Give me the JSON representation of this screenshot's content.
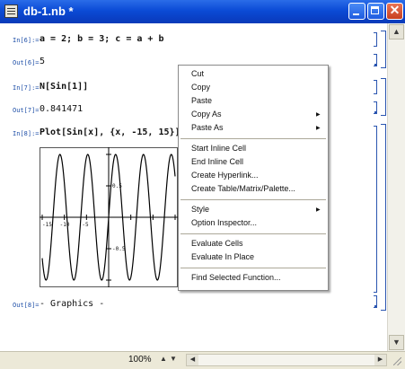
{
  "window": {
    "title": "db-1.nb *"
  },
  "cells": [
    {
      "in_label": "In[6]:=",
      "input": "a = 2; b = 3; c = a + b",
      "out_label": "Out[6]=",
      "output": "5"
    },
    {
      "in_label": "In[7]:=",
      "input": "N[Sin[1]]",
      "out_label": "Out[7]=",
      "output": "0.841471"
    },
    {
      "in_label": "In[8]:=",
      "input": "Plot[Sin[x], {x, -15, 15}]",
      "out_label": "Out[8]=",
      "output": "- Graphics -"
    }
  ],
  "plot": {
    "xticks": [
      "-15",
      "-10",
      "-5"
    ],
    "yticks": [
      "0.5",
      "-0.5"
    ]
  },
  "chart_data": {
    "type": "line",
    "function": "Sin[x]",
    "xlim": [
      -15,
      15
    ],
    "ylim": [
      -1,
      1
    ],
    "xticks": [
      -15,
      -10,
      -5,
      0,
      5,
      10,
      15
    ],
    "yticks": [
      -1,
      -0.5,
      0.5,
      1
    ],
    "series": [
      {
        "values_note": ""
      }
    ]
  },
  "context_menu": {
    "items": [
      {
        "label": "Cut"
      },
      {
        "label": "Copy"
      },
      {
        "label": "Paste"
      },
      {
        "label": "Copy As",
        "submenu": true
      },
      {
        "label": "Paste As",
        "submenu": true
      },
      {
        "label": "Start Inline Cell"
      },
      {
        "label": "End Inline Cell"
      },
      {
        "label": "Create Hyperlink..."
      },
      {
        "label": "Create Table/Matrix/Palette..."
      },
      {
        "label": "Style",
        "submenu": true
      },
      {
        "label": "Option Inspector..."
      },
      {
        "label": "Evaluate Cells"
      },
      {
        "label": "Evaluate In Place"
      },
      {
        "label": "Find Selected Function..."
      }
    ]
  },
  "statusbar": {
    "zoom": "100%"
  },
  "colors": {
    "titlebar": "#0b4bd6",
    "close": "#c8401f",
    "label": "#2050a8",
    "bracket": "#2a55b0"
  }
}
